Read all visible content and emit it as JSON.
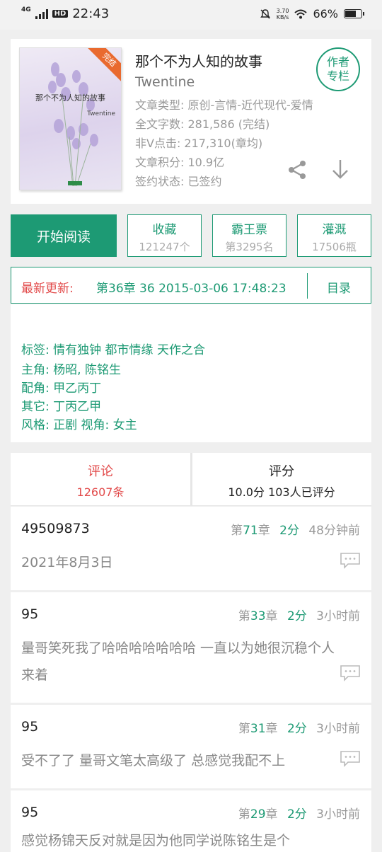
{
  "status_bar": {
    "network": "4G",
    "hd": "HD",
    "time": "22:43",
    "speed_value": "3.70",
    "speed_unit": "KB/s",
    "battery": "66%"
  },
  "book": {
    "cover_ribbon": "完结",
    "cover_title": "那个不为人知的故事",
    "cover_author": "Twentine",
    "title": "那个不为人知的故事",
    "author": "Twentine",
    "author_badge_line1": "作者",
    "author_badge_line2": "专栏",
    "meta": [
      "文章类型: 原创-言情-近代现代-爱情",
      "全文字数: 281,586 (完结)",
      "非V点击: 217,310(章均)",
      "文章积分: 10.9亿",
      "签约状态:  已签约"
    ]
  },
  "actions": {
    "read_label": "开始阅读",
    "buttons": [
      {
        "label": "收藏",
        "value": "121247个"
      },
      {
        "label": "霸王票",
        "value": "第3295名"
      },
      {
        "label": "灌溉",
        "value": "17506瓶"
      }
    ]
  },
  "latest_update": {
    "label": "最新更新:",
    "info": "第36章  36  2015-03-06 17:48:23",
    "toc_label": "目录"
  },
  "tags": {
    "rows": [
      "标签: 情有独钟  都市情缘  天作之合",
      "主角: 杨昭, 陈铭生",
      "配角: 甲乙丙丁",
      "其它: 丁丙乙甲",
      "风格: 正剧       视角: 女主"
    ]
  },
  "comment_tabs": [
    {
      "title": "评论",
      "sub": "12607条",
      "color": "#e24a4a"
    },
    {
      "title": "评分",
      "sub": "10.0分 103人已评分",
      "color": "#222222"
    }
  ],
  "comments": [
    {
      "user": "49509873",
      "chapter_prefix": "第",
      "chapter": "71",
      "chapter_suffix": "章",
      "score": "2分",
      "time": "48分钟前",
      "body": "2021年8月3日"
    },
    {
      "user": "95",
      "chapter_prefix": "第",
      "chapter": "33",
      "chapter_suffix": "章",
      "score": "2分",
      "time": "3小时前",
      "body": "量哥笑死我了哈哈哈哈哈哈哈 一直以为她很沉稳个人来着"
    },
    {
      "user": "95",
      "chapter_prefix": "第",
      "chapter": "31",
      "chapter_suffix": "章",
      "score": "2分",
      "time": "3小时前",
      "body": "受不了了 量哥文笔太高级了 总感觉我配不上"
    },
    {
      "user": "95",
      "chapter_prefix": "第",
      "chapter": "29",
      "chapter_suffix": "章",
      "score": "2分",
      "time": "3小时前",
      "body": "感觉杨锦天反对就是因为他同学说陈铭生是个"
    }
  ],
  "colors": {
    "accent": "#1d9a74",
    "red": "#e24a4a",
    "ribbon": "#e96a2f"
  }
}
